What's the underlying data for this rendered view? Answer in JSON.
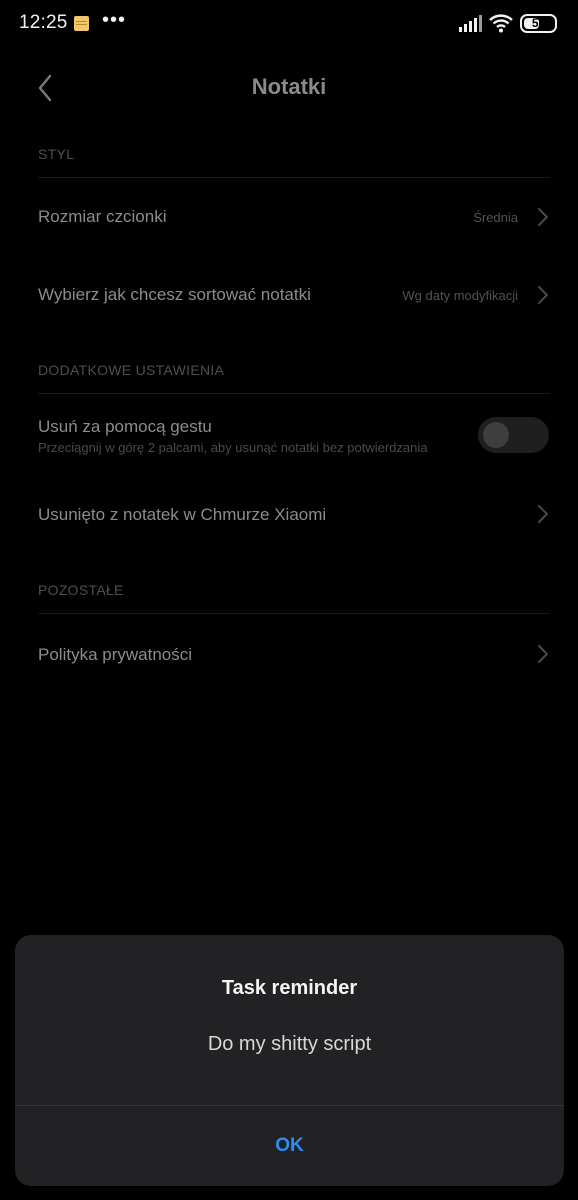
{
  "status_bar": {
    "time": "12:25",
    "more": "•••",
    "battery_level": "53",
    "battery_percent": 53
  },
  "header": {
    "title": "Notatki"
  },
  "sections": {
    "style": {
      "label": "STYL",
      "items": [
        {
          "label": "Rozmiar czcionki",
          "value": "Średnia"
        },
        {
          "label": "Wybierz jak chcesz sortować notatki",
          "value": "Wg daty modyfikacji"
        }
      ]
    },
    "additional": {
      "label": "DODATKOWE USTAWIENIA",
      "gesture": {
        "label": "Usuń za pomocą gestu",
        "description": "Przeciągnij w górę 2 palcami, aby usunąć notatki bez potwierdzania",
        "enabled": false
      },
      "cloud": {
        "label": "Usunięto z notatek w Chmurze Xiaomi"
      }
    },
    "other": {
      "label": "POZOSTAŁE",
      "items": [
        {
          "label": "Polityka prywatności"
        }
      ]
    }
  },
  "dialog": {
    "title": "Task reminder",
    "message": "Do my shitty script",
    "ok_label": "OK"
  },
  "colors": {
    "background": "#000000",
    "dialog_background": "#222224",
    "accent": "#2d8cf0",
    "note_icon": "#f2c66b"
  },
  "icons": [
    "note-icon",
    "more-icon",
    "signal-icon",
    "wifi-icon",
    "battery-icon",
    "back-icon",
    "chevron-right-icon"
  ]
}
